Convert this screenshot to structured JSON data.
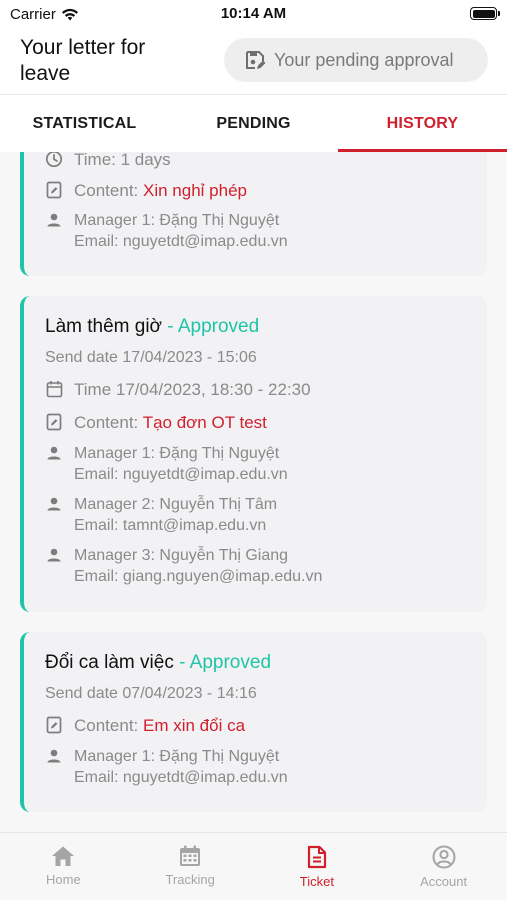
{
  "status_bar": {
    "carrier": "Carrier",
    "time": "10:14 AM"
  },
  "header": {
    "title": "Your letter for leave",
    "pending_button": "Your pending approval"
  },
  "tabs": [
    {
      "label": "STATISTICAL",
      "active": false
    },
    {
      "label": "PENDING",
      "active": false
    },
    {
      "label": "HISTORY",
      "active": true
    }
  ],
  "cards": [
    {
      "time": "Time: 1 days",
      "content_label": "Content:",
      "content_value": "Xin nghỉ phép",
      "managers": [
        {
          "name": "Manager 1: Đặng Thị Nguyệt",
          "email": "Email: nguyetdt@imap.edu.vn"
        }
      ]
    },
    {
      "title": "Làm thêm giờ",
      "separator": " - ",
      "status": "Approved",
      "send_date": "Send date 17/04/2023 - 15:06",
      "time": "Time 17/04/2023, 18:30 - 22:30",
      "content_label": "Content:",
      "content_value": "Tạo đơn OT test",
      "managers": [
        {
          "name": "Manager 1: Đặng Thị Nguyệt",
          "email": "Email: nguyetdt@imap.edu.vn"
        },
        {
          "name": "Manager 2: Nguyễn Thị Tâm",
          "email": "Email: tamnt@imap.edu.vn"
        },
        {
          "name": "Manager 3: Nguyễn Thị Giang",
          "email": "Email: giang.nguyen@imap.edu.vn"
        }
      ]
    },
    {
      "title": "Đổi ca làm việc",
      "separator": " - ",
      "status": "Approved",
      "send_date": "Send date 07/04/2023 - 14:16",
      "content_label": "Content:",
      "content_value": "Em xin đổi ca",
      "managers": [
        {
          "name": "Manager 1: Đặng Thị Nguyệt",
          "email": "Email: nguyetdt@imap.edu.vn"
        }
      ]
    }
  ],
  "bottom_nav": [
    {
      "label": "Home",
      "icon": "home-icon",
      "active": false
    },
    {
      "label": "Tracking",
      "icon": "calendar-icon",
      "active": false
    },
    {
      "label": "Ticket",
      "icon": "document-icon",
      "active": true
    },
    {
      "label": "Account",
      "icon": "account-icon",
      "active": false
    }
  ],
  "colors": {
    "accent": "#d0202e",
    "approved": "#1fc4a8",
    "muted": "#8a8a8a"
  }
}
